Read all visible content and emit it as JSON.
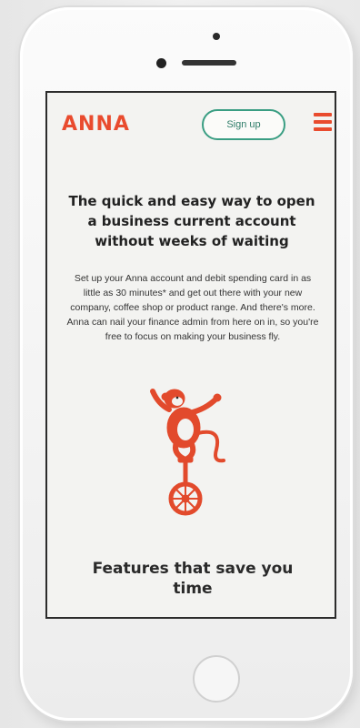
{
  "header": {
    "logo_text": "ANNA",
    "signup_label": "Sign up",
    "menu_icon": "hamburger-menu-icon"
  },
  "hero": {
    "headline": "The quick and easy way to open a business current account without weeks of waiting",
    "body": "Set up your Anna account and debit spending card in as little as 30 minutes* and get out there with your new company, coffee shop or product range. And there's more. Anna can nail your finance admin from here on in, so you're free to focus on making your business fly.",
    "illustration": "monkey-on-unicycle-icon"
  },
  "features": {
    "heading": "Features that save you time"
  },
  "colors": {
    "brand": "#e94b2e",
    "accent_green": "#3a9e83",
    "screen_bg": "#f3f3f1"
  }
}
